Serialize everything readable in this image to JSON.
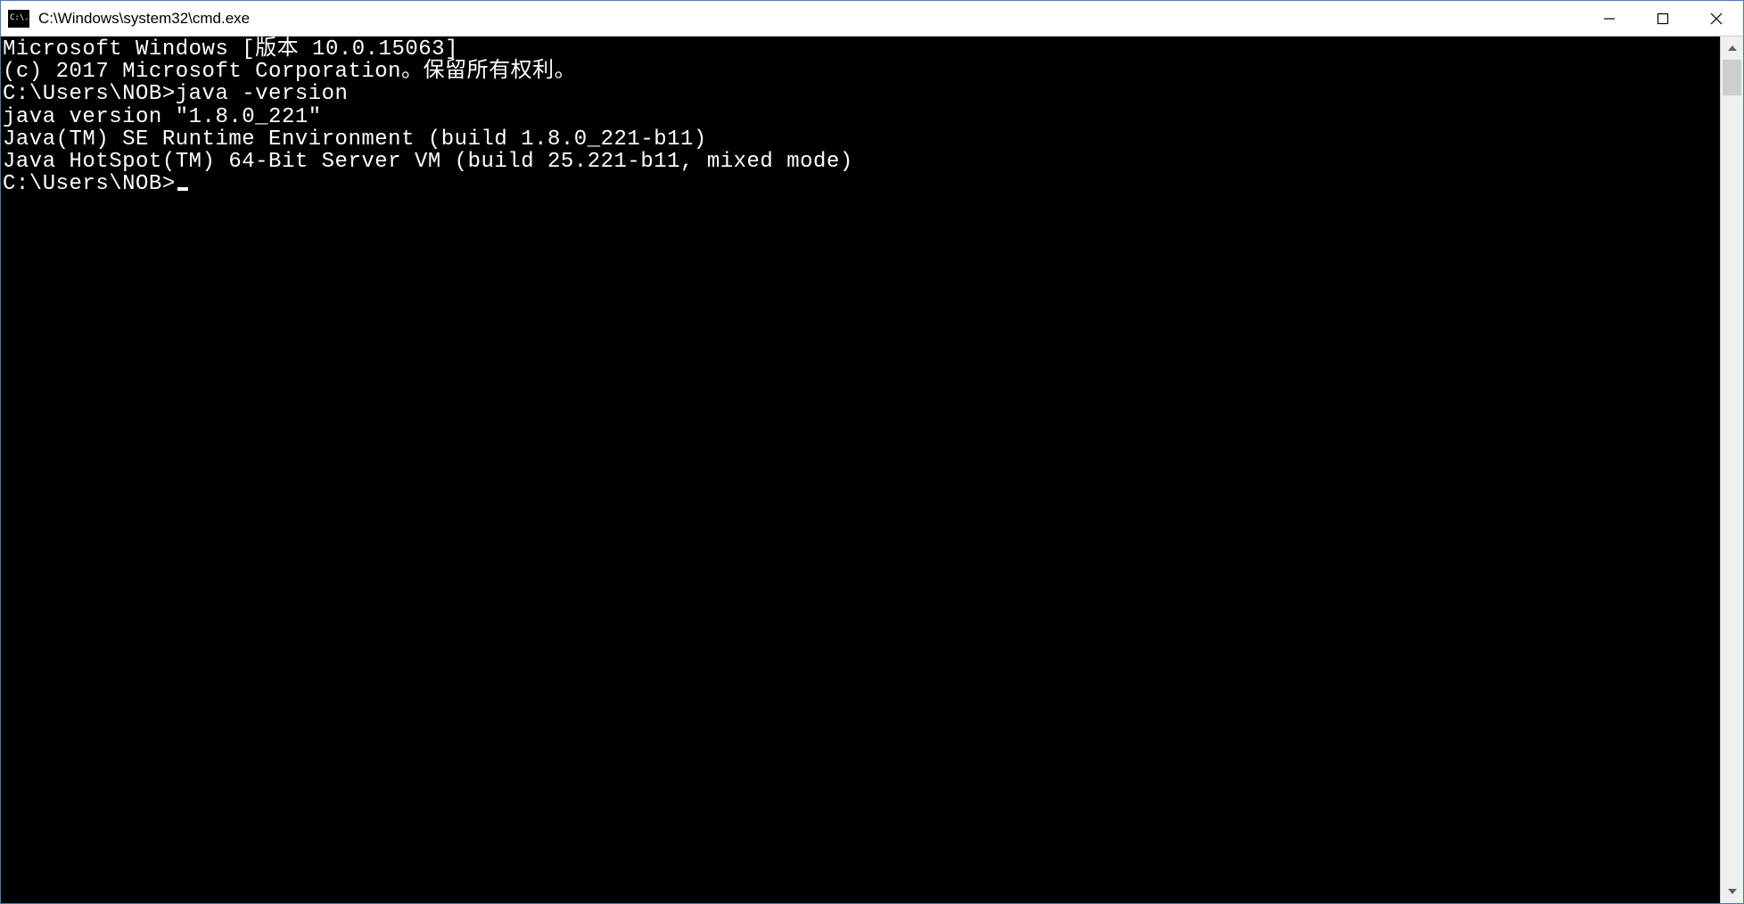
{
  "titlebar": {
    "icon_text": "C:\\.",
    "title": "C:\\Windows\\system32\\cmd.exe"
  },
  "terminal": {
    "lines": [
      "Microsoft Windows [版本 10.0.15063]",
      "(c) 2017 Microsoft Corporation。保留所有权利。",
      "",
      "C:\\Users\\NOB>java -version",
      "java version \"1.8.0_221\"",
      "Java(TM) SE Runtime Environment (build 1.8.0_221-b11)",
      "Java HotSpot(TM) 64-Bit Server VM (build 25.221-b11, mixed mode)",
      ""
    ],
    "prompt": "C:\\Users\\NOB>"
  }
}
